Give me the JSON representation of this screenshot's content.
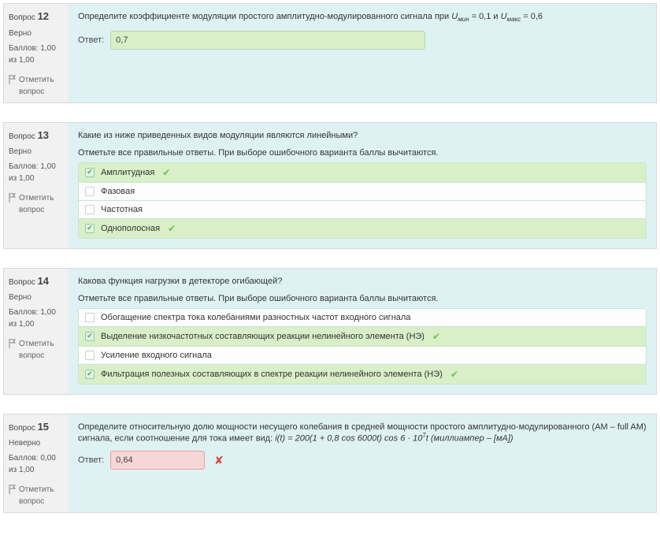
{
  "labels": {
    "question_prefix": "Вопрос",
    "answer_label": "Ответ:",
    "flag_label": "Отметить вопрос",
    "instruction_multi": "Отметьте все правильные ответы. При выборе ошибочного варианта баллы вычитаются."
  },
  "q12": {
    "number": "12",
    "status": "Верно",
    "score": "Баллов: 1,00 из 1,00",
    "text_before": "Определите коэффициенте модуляции простого амплитудно-модулированного сигнала при ",
    "umin_sym": "U",
    "umin_sub": "мин",
    "umin_val": " = 0,1 и ",
    "umax_sym": "U",
    "umax_sub": "макс",
    "umax_val": " = 0,6",
    "answer": "0,7"
  },
  "q13": {
    "number": "13",
    "status": "Верно",
    "score": "Баллов: 1,00 из 1,00",
    "text": "Какие из ниже приведенных видов модуляции являются линейными?",
    "options": [
      {
        "label": "Амплитудная",
        "checked": true,
        "correct": true
      },
      {
        "label": "Фазовая",
        "checked": false,
        "correct": false
      },
      {
        "label": "Частотная",
        "checked": false,
        "correct": false
      },
      {
        "label": "Однополосная",
        "checked": true,
        "correct": true
      }
    ]
  },
  "q14": {
    "number": "14",
    "status": "Верно",
    "score": "Баллов: 1,00 из 1,00",
    "text": "Какова функция нагрузки в детекторе огибающей?",
    "options": [
      {
        "label": "Обогащение спектра тока колебаниями разностных частот входного сигнала",
        "checked": false,
        "correct": false
      },
      {
        "label": "Выделение низкочастотных составляющих реакции нелинейного элемента (НЭ)",
        "checked": true,
        "correct": true
      },
      {
        "label": "Усиление входного сигнала",
        "checked": false,
        "correct": false
      },
      {
        "label": "Фильтрация полезных составляющих в спектре реакции нелинейного элемента (НЭ)",
        "checked": true,
        "correct": true
      }
    ]
  },
  "q15": {
    "number": "15",
    "status": "Неверно",
    "score": "Баллов: 0,00 из 1,00",
    "text_a": "Определите относительную долю мощности несущего колебания в средней мощности простого амплитудно-модулированного (AM – full AM) сигнала, если соотношение для тока имеет вид: ",
    "formula": "i(t) = 200(1 + 0,8 cos 6000t) cos 6 · 10",
    "exp": "7",
    "text_b": "t (миллиампер – [мА])",
    "answer": "0,64"
  }
}
